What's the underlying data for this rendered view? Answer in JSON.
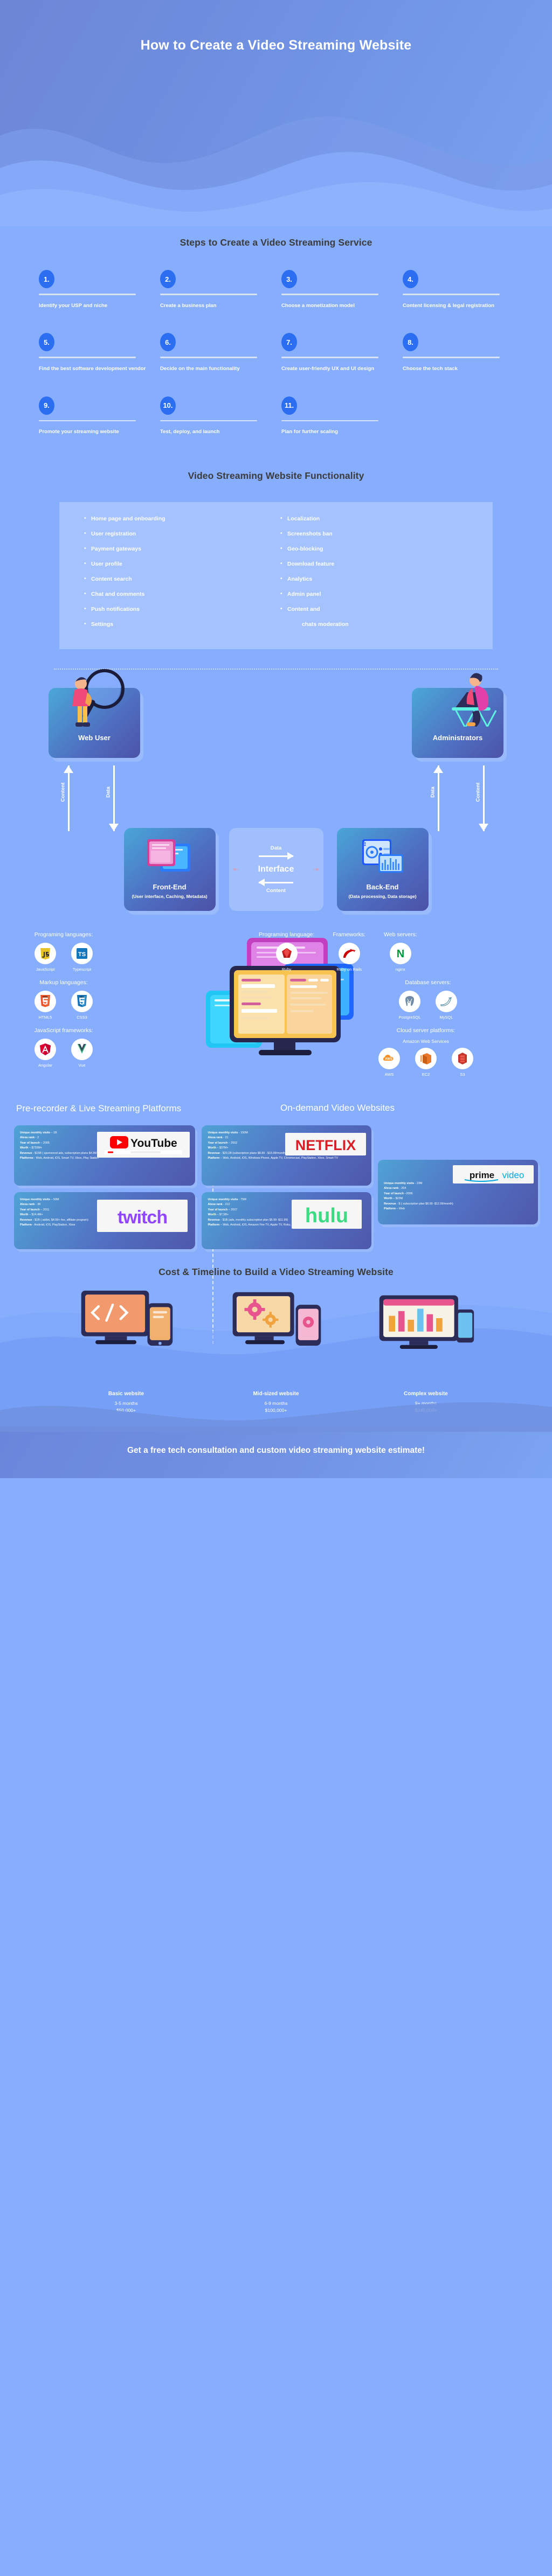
{
  "hero": {
    "title": "How to Create a Video Streaming Website"
  },
  "steps_section": {
    "title": "Steps to Create a Video Streaming Service",
    "items": [
      {
        "num": "1.",
        "label": "Identify your USP and niche"
      },
      {
        "num": "2.",
        "label": "Create a business plan"
      },
      {
        "num": "3.",
        "label": "Choose a monetization model"
      },
      {
        "num": "4.",
        "label": "Content licensing & legal registration"
      },
      {
        "num": "5.",
        "label": "Find the best software development vendor"
      },
      {
        "num": "6.",
        "label": "Decide on the main functionality"
      },
      {
        "num": "7.",
        "label": "Create user-friendly UX and UI design"
      },
      {
        "num": "8.",
        "label": "Choose the tech stack"
      },
      {
        "num": "9.",
        "label": "Promote your streaming website"
      },
      {
        "num": "10.",
        "label": "Test, deploy, and launch"
      },
      {
        "num": "11.",
        "label": "Plan for further scaling"
      }
    ]
  },
  "functionality": {
    "title": "Video Streaming Website Functionality",
    "left": [
      "Home page and onboarding",
      "User registration",
      "Payment gateways",
      "User profile",
      "Content search",
      "Chat and comments",
      "Push notifications",
      "Settings"
    ],
    "right": [
      "Localization",
      "Screenshots ban",
      "Geo-blocking",
      "Download feature",
      "Analytics",
      "Admin panel",
      "Content and",
      "chats moderation"
    ]
  },
  "architecture": {
    "web_user": "Web User",
    "administrators": "Administrators",
    "left_arrow_up": "Content",
    "left_arrow_down": "Data",
    "right_arrow_up": "Data",
    "right_arrow_down": "Content",
    "frontend": {
      "name": "Front-End",
      "sub": "(User interface, Caching, Metadata)"
    },
    "backend": {
      "name": "Back-End",
      "sub": "(Data processing, Data storage)"
    },
    "interface": {
      "top": "Data",
      "title": "Interface",
      "bottom": "Content"
    }
  },
  "tech_stack": {
    "left": [
      {
        "heading": "Programing languages:",
        "logos": [
          {
            "name": "JavaScript",
            "icon": "javascript-icon"
          },
          {
            "name": "Typescript",
            "icon": "typescript-icon"
          }
        ]
      },
      {
        "heading": "Markup languages:",
        "logos": [
          {
            "name": "HTML5",
            "icon": "html5-icon"
          },
          {
            "name": "CSS3",
            "icon": "css3-icon"
          }
        ]
      },
      {
        "heading": "JavaScript frameworks:",
        "logos": [
          {
            "name": "Angular",
            "icon": "angular-icon"
          },
          {
            "name": "Vue",
            "icon": "vue-icon"
          }
        ]
      }
    ],
    "right_top": [
      {
        "heading": "Programing language:",
        "logos": [
          {
            "name": "Ruby",
            "icon": "ruby-icon"
          }
        ]
      },
      {
        "heading": "Frameworks:",
        "logos": [
          {
            "name": "Ruby on Rails",
            "icon": "rails-icon"
          }
        ]
      },
      {
        "heading": "Web servers:",
        "logos": [
          {
            "name": "nginx",
            "icon": "nginx-icon"
          }
        ]
      }
    ],
    "database": {
      "heading": "Database servers:",
      "logos": [
        {
          "name": "PostgreSQL",
          "icon": "postgresql-icon"
        },
        {
          "name": "MySQL",
          "icon": "mysql-icon"
        }
      ]
    },
    "cloud": {
      "heading": "Cloud server platforms:",
      "sub": "Amazon Web Services",
      "logos": [
        {
          "name": "AWS",
          "icon": "aws-icon"
        },
        {
          "name": "EC2",
          "icon": "ec2-icon"
        },
        {
          "name": "S3",
          "icon": "s3-icon"
        }
      ]
    }
  },
  "platforms": {
    "left_title": "Pre-recorder & Live Streaming Platforms",
    "right_title": "On-demand Video Websites",
    "cards": [
      {
        "brand": "YouTube",
        "column": "left",
        "lines": [
          {
            "label": "Unique monthly visits",
            "value": " – 1B"
          },
          {
            "label": "Alexa rank",
            "value": " - 2"
          },
          {
            "label": "Year of launch",
            "value": " – 2005"
          },
          {
            "label": "Worth",
            "value": " – $733M+"
          },
          {
            "label": "Revenue",
            "value": " - $15B ( sponsored ads, subscription plans $4.99/month+)"
          },
          {
            "label": "Platforms",
            "value": " - Web, Android, iOS, Smart TV, Xbox, Play Station"
          }
        ]
      },
      {
        "brand": "twitch",
        "column": "left",
        "lines": [
          {
            "label": "Unique monthly visits",
            "value": " – 50M"
          },
          {
            "label": "Alexa rank",
            "value": " - 38"
          },
          {
            "label": "Year of launch",
            "value": " – 2011"
          },
          {
            "label": "Worth",
            "value": " – $14,4M+"
          },
          {
            "label": "Revenue",
            "value": " - $1B ( addst, $4.99+ fee, affiliate program)"
          },
          {
            "label": "Platform",
            "value": " - Android, iOS, PlayStation, Xbox"
          }
        ]
      },
      {
        "brand": "NETFLIX",
        "column": "mid",
        "lines": [
          {
            "label": "Unique monthly visits",
            "value": " - 150M"
          },
          {
            "label": "Alexa rank",
            "value": " - 21"
          },
          {
            "label": "Year of launch",
            "value": " – 2002"
          },
          {
            "label": "Worth",
            "value": " – $37M+"
          },
          {
            "label": "Revenue",
            "value": " - $20,1B (subscription plans $8.99 - $15.99/month)"
          },
          {
            "label": "Platform",
            "value": " – Web, Android, iOS, Windows Phone, Apple TV, Chromecast, PlayStation, Xbox, Smart TV"
          }
        ]
      },
      {
        "brand": "hulu",
        "column": "mid",
        "lines": [
          {
            "label": "Unique monthly visits",
            "value": " - 75M"
          },
          {
            "label": "Alexa rank",
            "value": " - 212"
          },
          {
            "label": "Year of launch",
            "value": " – 2007"
          },
          {
            "label": "Worth",
            "value": " – $7,5B+"
          },
          {
            "label": "Revenue",
            "value": " - $1B (ads, monthly subscription plan $5.99 -$11.99)"
          },
          {
            "label": "Platform",
            "value": " – Web, Android, iOS, Amazon Fire TV, Apple TV, Roku, PlayStation, Xbox, Nintendo, Smart TV"
          }
        ]
      },
      {
        "brand": "prime video",
        "column": "right",
        "lines": [
          {
            "label": "Unique monthly visits",
            "value": " - 23M"
          },
          {
            "label": "Alexa rank",
            "value": " - 264"
          },
          {
            "label": "Year of launch",
            "value": " –2006"
          },
          {
            "label": "Worth",
            "value": " – $23M"
          },
          {
            "label": "Revenue",
            "value": " - $ ( subscription plan $8.99 -$12.99/month)"
          },
          {
            "label": "Platform",
            "value": " – Web"
          }
        ]
      }
    ]
  },
  "cost": {
    "title": "Cost & Timeline to Build a Video Streaming Website",
    "items": [
      {
        "name": "Basic website",
        "time": "3-5 months",
        "price": "$50,000+",
        "icon": "code-devices-icon"
      },
      {
        "name": "Mid-sized website",
        "time": "6-9 months",
        "price": "$100,000+",
        "icon": "gears-devices-icon"
      },
      {
        "name": "Complex website",
        "time": "9+ months",
        "price": "$240,000+",
        "icon": "desktop-chart-icon"
      }
    ]
  },
  "cta": {
    "text": "Get a free tech consultation and custom video streaming website estimate!"
  },
  "colors": {
    "background": "#86aefc",
    "hero_gradient_start": "#6d86d6",
    "hero_gradient_end": "#78a1f0",
    "badge": "#2c6ef2",
    "card_gradient_start": "#4fa2d5",
    "card_gradient_end": "#4e58ab",
    "title_dark": "#3c3c3c",
    "white": "#ffffff"
  }
}
